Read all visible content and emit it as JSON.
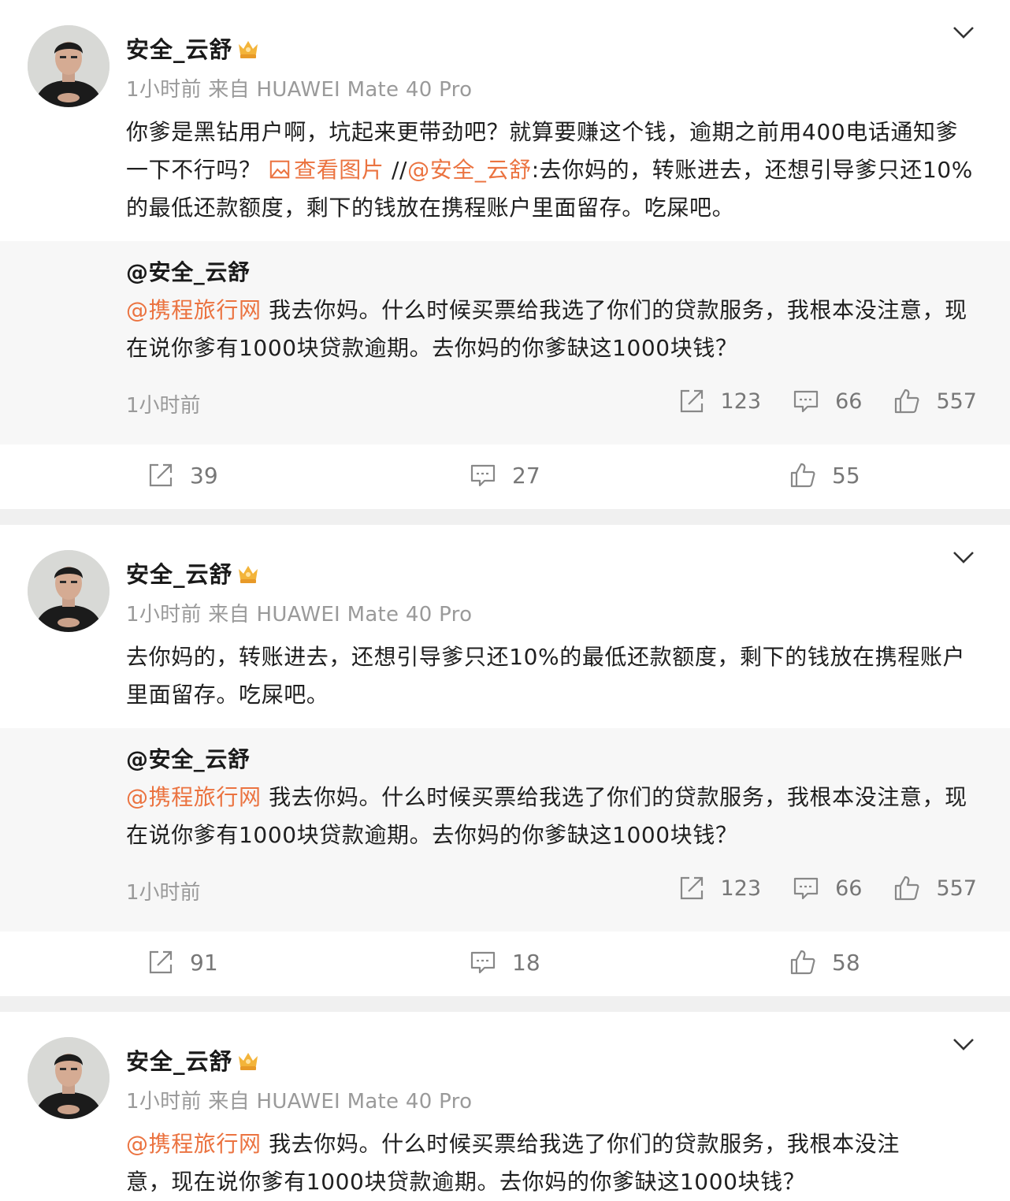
{
  "posts": [
    {
      "author": "安全_云舒",
      "meta": "1小时前  来自 HUAWEI Mate 40 Pro",
      "text_parts": [
        "你爹是黑钻用户啊，坑起来更带劲吧？就算要赚这个钱，逾期之前用400电话通知爹一下不行吗？ ",
        "查看图片",
        " //",
        "@安全_云舒",
        ":去你妈的，转账进去，还想引导爹只还10%的最低还款额度，剩下的钱放在携程账户里面留存。吃屎吧。"
      ],
      "repost": {
        "author": "@安全_云舒",
        "mention": "@携程旅行网",
        "text": " 我去你妈。什么时候买票给我选了你们的贷款服务，我根本没注意，现在说你爹有1000块贷款逾期。去你妈的你爹缺这1000块钱？",
        "time": "1小时前",
        "share": "123",
        "comment": "66",
        "like": "557"
      },
      "actions": {
        "share": "39",
        "comment": "27",
        "like": "55"
      }
    },
    {
      "author": "安全_云舒",
      "meta": "1小时前  来自 HUAWEI Mate 40 Pro",
      "text": "去你妈的，转账进去，还想引导爹只还10%的最低还款额度，剩下的钱放在携程账户里面留存。吃屎吧。",
      "repost": {
        "author": "@安全_云舒",
        "mention": "@携程旅行网",
        "text": " 我去你妈。什么时候买票给我选了你们的贷款服务，我根本没注意，现在说你爹有1000块贷款逾期。去你妈的你爹缺这1000块钱？",
        "time": "1小时前",
        "share": "123",
        "comment": "66",
        "like": "557"
      },
      "actions": {
        "share": "91",
        "comment": "18",
        "like": "58"
      }
    },
    {
      "author": "安全_云舒",
      "meta": "1小时前  来自 HUAWEI Mate 40 Pro",
      "mention": "@携程旅行网",
      "text": " 我去你妈。什么时候买票给我选了你们的贷款服务，我根本没注意，现在说你爹有1000块贷款逾期。去你妈的你爹缺这1000块钱？"
    }
  ],
  "colors": {
    "link": "#eb7340",
    "muted": "#9a9a9a",
    "repost_bg": "#f7f7f7",
    "separator": "#f0f0f0"
  },
  "icons": [
    "avatar-photo",
    "crown-vip-icon",
    "chevron-down-icon",
    "image-link-icon",
    "share-icon",
    "comment-icon",
    "like-icon"
  ]
}
